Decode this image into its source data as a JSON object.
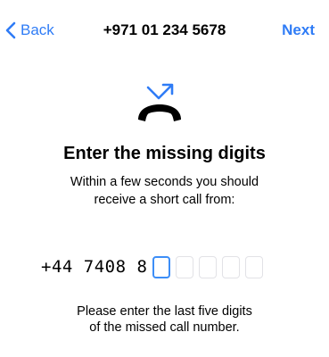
{
  "theme": {
    "accent": "#2f7cf6",
    "text": "#000000",
    "box_border": "#e2e2e6",
    "box_active_border": "#3d8ef7"
  },
  "nav": {
    "back_label": "Back",
    "back_icon": "chevron-left-icon",
    "title": "+971 01 234 5678",
    "next_label": "Next"
  },
  "illustration": {
    "icon": "missed-call-icon"
  },
  "main": {
    "heading": "Enter the missing digits",
    "subtext_line1": "Within a few seconds you should",
    "subtext_line2": "receive a short call from:"
  },
  "code": {
    "prefix": "+44 7408 8",
    "digits": [
      "",
      "",
      "",
      "",
      ""
    ],
    "active_index": 0
  },
  "footer": {
    "line1": "Please enter the last five digits",
    "line2": "of the missed call number."
  }
}
